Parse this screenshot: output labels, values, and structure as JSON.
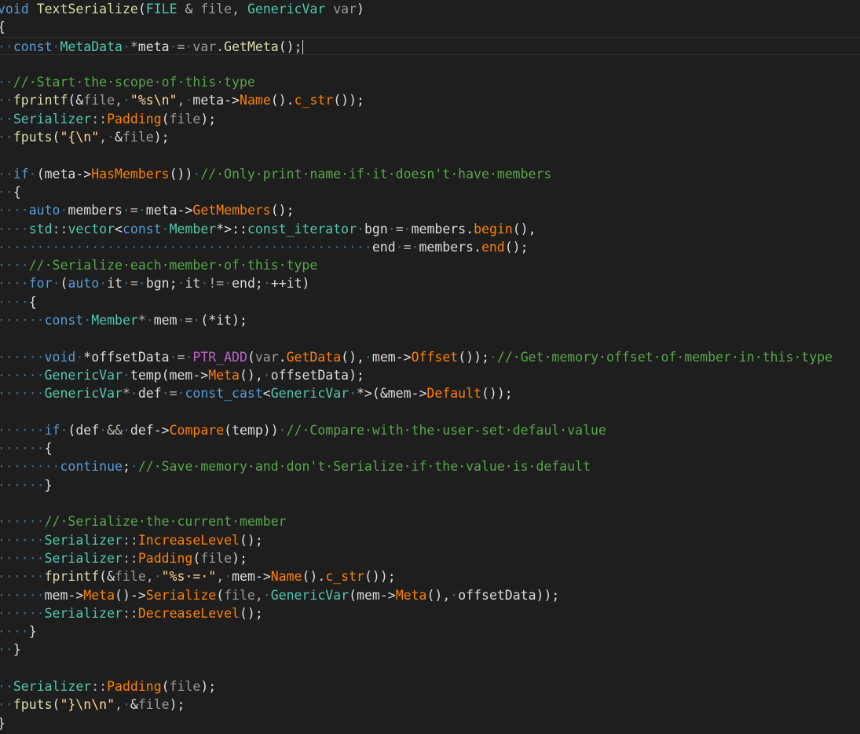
{
  "editor": {
    "lines": [
      [
        [
          "kw",
          "void"
        ],
        [
          "ws",
          " "
        ],
        [
          "fn",
          "TextSerialize"
        ],
        [
          "plain",
          "("
        ],
        [
          "type",
          "FILE"
        ],
        [
          "ws",
          " "
        ],
        [
          "op",
          "&"
        ],
        [
          "ws",
          " "
        ],
        [
          "param",
          "file"
        ],
        [
          "op",
          ","
        ],
        [
          "ws",
          " "
        ],
        [
          "type",
          "GenericVar"
        ],
        [
          "ws",
          " "
        ],
        [
          "param",
          "var"
        ],
        [
          "plain",
          ")"
        ]
      ],
      [
        [
          "plain",
          "{"
        ]
      ],
      [
        [
          "ws",
          "··"
        ],
        [
          "kw",
          "const"
        ],
        [
          "ws",
          "·"
        ],
        [
          "type",
          "MetaData"
        ],
        [
          "ws",
          "·"
        ],
        [
          "op",
          "*"
        ],
        [
          "plain",
          "meta"
        ],
        [
          "ws",
          "·"
        ],
        [
          "op",
          "="
        ],
        [
          "ws",
          "·"
        ],
        [
          "param",
          "var"
        ],
        [
          "op",
          "."
        ],
        [
          "fn",
          "GetMeta"
        ],
        [
          "plain",
          "();"
        ]
      ],
      [],
      [
        [
          "ws",
          "··"
        ],
        [
          "com",
          "//·Start·the·scope·of·this·type"
        ]
      ],
      [
        [
          "ws",
          "··"
        ],
        [
          "fn",
          "fprintf"
        ],
        [
          "plain",
          "(&"
        ],
        [
          "param",
          "file"
        ],
        [
          "op",
          ","
        ],
        [
          "ws",
          "·"
        ],
        [
          "strx",
          "\"%s\\n\""
        ],
        [
          "op",
          ","
        ],
        [
          "ws",
          "·"
        ],
        [
          "plain",
          "meta->"
        ],
        [
          "fld",
          "Name"
        ],
        [
          "plain",
          "()."
        ],
        [
          "fld",
          "c_str"
        ],
        [
          "plain",
          "());"
        ]
      ],
      [
        [
          "ws",
          "··"
        ],
        [
          "ns",
          "Serializer"
        ],
        [
          "op",
          "::"
        ],
        [
          "fld",
          "Padding"
        ],
        [
          "plain",
          "("
        ],
        [
          "param",
          "file"
        ],
        [
          "plain",
          ");"
        ]
      ],
      [
        [
          "ws",
          "··"
        ],
        [
          "fn",
          "fputs"
        ],
        [
          "plain",
          "("
        ],
        [
          "strx",
          "\"{\\n\""
        ],
        [
          "op",
          ","
        ],
        [
          "ws",
          "·"
        ],
        [
          "plain",
          "&"
        ],
        [
          "param",
          "file"
        ],
        [
          "plain",
          ");"
        ]
      ],
      [],
      [
        [
          "ws",
          "··"
        ],
        [
          "kw",
          "if"
        ],
        [
          "ws",
          "·"
        ],
        [
          "plain",
          "(meta->"
        ],
        [
          "fld",
          "HasMembers"
        ],
        [
          "plain",
          "())"
        ],
        [
          "ws",
          "·"
        ],
        [
          "com",
          "//·Only·print·name·if·it·doesn't·have·members"
        ]
      ],
      [
        [
          "ws",
          "··"
        ],
        [
          "plain",
          "{"
        ]
      ],
      [
        [
          "ws",
          "····"
        ],
        [
          "kw",
          "auto"
        ],
        [
          "ws",
          "·"
        ],
        [
          "plain",
          "members"
        ],
        [
          "ws",
          "·"
        ],
        [
          "op",
          "="
        ],
        [
          "ws",
          "·"
        ],
        [
          "plain",
          "meta->"
        ],
        [
          "fld",
          "GetMembers"
        ],
        [
          "plain",
          "();"
        ]
      ],
      [
        [
          "ws",
          "····"
        ],
        [
          "ns",
          "std"
        ],
        [
          "op",
          "::"
        ],
        [
          "type",
          "vector"
        ],
        [
          "plain",
          "<"
        ],
        [
          "kw",
          "const"
        ],
        [
          "ws",
          "·"
        ],
        [
          "type",
          "Member"
        ],
        [
          "plain",
          "*>::"
        ],
        [
          "type",
          "const_iterator"
        ],
        [
          "ws",
          "·"
        ],
        [
          "plain",
          "bgn"
        ],
        [
          "ws",
          "·"
        ],
        [
          "op",
          "="
        ],
        [
          "ws",
          "·"
        ],
        [
          "plain",
          "members."
        ],
        [
          "fld",
          "begin"
        ],
        [
          "plain",
          "(),"
        ]
      ],
      [
        [
          "ws",
          "················································"
        ],
        [
          "plain",
          "end"
        ],
        [
          "ws",
          "·"
        ],
        [
          "op",
          "="
        ],
        [
          "ws",
          "·"
        ],
        [
          "plain",
          "members."
        ],
        [
          "fld",
          "end"
        ],
        [
          "plain",
          "();"
        ]
      ],
      [
        [
          "ws",
          "····"
        ],
        [
          "com",
          "//·Serialize·each·member·of·this·type"
        ]
      ],
      [
        [
          "ws",
          "····"
        ],
        [
          "kw",
          "for"
        ],
        [
          "ws",
          "·"
        ],
        [
          "plain",
          "("
        ],
        [
          "kw",
          "auto"
        ],
        [
          "ws",
          "·"
        ],
        [
          "plain",
          "it"
        ],
        [
          "ws",
          "·"
        ],
        [
          "op",
          "="
        ],
        [
          "ws",
          "·"
        ],
        [
          "plain",
          "bgn;"
        ],
        [
          "ws",
          "·"
        ],
        [
          "plain",
          "it"
        ],
        [
          "ws",
          "·"
        ],
        [
          "op",
          "!="
        ],
        [
          "ws",
          "·"
        ],
        [
          "plain",
          "end;"
        ],
        [
          "ws",
          "·"
        ],
        [
          "plain",
          "++it)"
        ]
      ],
      [
        [
          "ws",
          "····"
        ],
        [
          "plain",
          "{"
        ]
      ],
      [
        [
          "ws",
          "······"
        ],
        [
          "kw",
          "const"
        ],
        [
          "ws",
          "·"
        ],
        [
          "type",
          "Member"
        ],
        [
          "op",
          "*"
        ],
        [
          "ws",
          "·"
        ],
        [
          "plain",
          "mem"
        ],
        [
          "ws",
          "·"
        ],
        [
          "op",
          "="
        ],
        [
          "ws",
          "·"
        ],
        [
          "plain",
          "(*it);"
        ]
      ],
      [],
      [
        [
          "ws",
          "······"
        ],
        [
          "kw",
          "void"
        ],
        [
          "ws",
          "·"
        ],
        [
          "plain",
          "*offsetData"
        ],
        [
          "ws",
          "·"
        ],
        [
          "op",
          "="
        ],
        [
          "ws",
          "·"
        ],
        [
          "macro",
          "PTR_ADD"
        ],
        [
          "plain",
          "("
        ],
        [
          "param",
          "var"
        ],
        [
          "plain",
          "."
        ],
        [
          "fld",
          "GetData"
        ],
        [
          "plain",
          "(),"
        ],
        [
          "ws",
          "·"
        ],
        [
          "plain",
          "mem->"
        ],
        [
          "fld",
          "Offset"
        ],
        [
          "plain",
          "());"
        ],
        [
          "ws",
          "·"
        ],
        [
          "com",
          "//·Get·memory·offset·of·member·in·this·type"
        ]
      ],
      [
        [
          "ws",
          "······"
        ],
        [
          "type",
          "GenericVar"
        ],
        [
          "ws",
          "·"
        ],
        [
          "plain",
          "temp(mem->"
        ],
        [
          "fld",
          "Meta"
        ],
        [
          "plain",
          "(),"
        ],
        [
          "ws",
          "·"
        ],
        [
          "plain",
          "offsetData);"
        ]
      ],
      [
        [
          "ws",
          "······"
        ],
        [
          "type",
          "GenericVar"
        ],
        [
          "op",
          "*"
        ],
        [
          "ws",
          "·"
        ],
        [
          "plain",
          "def"
        ],
        [
          "ws",
          "·"
        ],
        [
          "op",
          "="
        ],
        [
          "ws",
          "·"
        ],
        [
          "kw",
          "const_cast"
        ],
        [
          "plain",
          "<"
        ],
        [
          "type",
          "GenericVar"
        ],
        [
          "ws",
          "·"
        ],
        [
          "plain",
          "*>(&mem->"
        ],
        [
          "fld",
          "Default"
        ],
        [
          "plain",
          "());"
        ]
      ],
      [],
      [
        [
          "ws",
          "······"
        ],
        [
          "kw",
          "if"
        ],
        [
          "ws",
          "·"
        ],
        [
          "plain",
          "(def"
        ],
        [
          "ws",
          "·"
        ],
        [
          "op",
          "&&"
        ],
        [
          "ws",
          "·"
        ],
        [
          "plain",
          "def->"
        ],
        [
          "fld",
          "Compare"
        ],
        [
          "plain",
          "(temp))"
        ],
        [
          "ws",
          "·"
        ],
        [
          "com",
          "//·Compare·with·the·user-set·defaul·value"
        ]
      ],
      [
        [
          "ws",
          "······"
        ],
        [
          "plain",
          "{"
        ]
      ],
      [
        [
          "ws",
          "········"
        ],
        [
          "kw",
          "continue"
        ],
        [
          "plain",
          ";"
        ],
        [
          "ws",
          "·"
        ],
        [
          "com",
          "//·Save·memory·and·don't·Serialize·if·the·value·is·default"
        ]
      ],
      [
        [
          "ws",
          "······"
        ],
        [
          "plain",
          "}"
        ]
      ],
      [],
      [
        [
          "ws",
          "······"
        ],
        [
          "com",
          "//·Serialize·the·current·member"
        ]
      ],
      [
        [
          "ws",
          "······"
        ],
        [
          "ns",
          "Serializer"
        ],
        [
          "op",
          "::"
        ],
        [
          "fld",
          "IncreaseLevel"
        ],
        [
          "plain",
          "();"
        ]
      ],
      [
        [
          "ws",
          "······"
        ],
        [
          "ns",
          "Serializer"
        ],
        [
          "op",
          "::"
        ],
        [
          "fld",
          "Padding"
        ],
        [
          "plain",
          "("
        ],
        [
          "param",
          "file"
        ],
        [
          "plain",
          ");"
        ]
      ],
      [
        [
          "ws",
          "······"
        ],
        [
          "fn",
          "fprintf"
        ],
        [
          "plain",
          "(&"
        ],
        [
          "param",
          "file"
        ],
        [
          "op",
          ","
        ],
        [
          "ws",
          "·"
        ],
        [
          "strx",
          "\"%s·=·\""
        ],
        [
          "op",
          ","
        ],
        [
          "ws",
          "·"
        ],
        [
          "plain",
          "mem->"
        ],
        [
          "fld",
          "Name"
        ],
        [
          "plain",
          "()."
        ],
        [
          "fld",
          "c_str"
        ],
        [
          "plain",
          "());"
        ]
      ],
      [
        [
          "ws",
          "······"
        ],
        [
          "plain",
          "mem->"
        ],
        [
          "fld",
          "Meta"
        ],
        [
          "plain",
          "()->"
        ],
        [
          "fld",
          "Serialize"
        ],
        [
          "plain",
          "("
        ],
        [
          "param",
          "file"
        ],
        [
          "op",
          ","
        ],
        [
          "ws",
          "·"
        ],
        [
          "type",
          "GenericVar"
        ],
        [
          "plain",
          "(mem->"
        ],
        [
          "fld",
          "Meta"
        ],
        [
          "plain",
          "(),"
        ],
        [
          "ws",
          "·"
        ],
        [
          "plain",
          "offsetData));"
        ]
      ],
      [
        [
          "ws",
          "······"
        ],
        [
          "ns",
          "Serializer"
        ],
        [
          "op",
          "::"
        ],
        [
          "fld",
          "DecreaseLevel"
        ],
        [
          "plain",
          "();"
        ]
      ],
      [
        [
          "ws",
          "····"
        ],
        [
          "plain",
          "}"
        ]
      ],
      [
        [
          "ws",
          "··"
        ],
        [
          "plain",
          "}"
        ]
      ],
      [],
      [
        [
          "ws",
          "··"
        ],
        [
          "ns",
          "Serializer"
        ],
        [
          "op",
          "::"
        ],
        [
          "fld",
          "Padding"
        ],
        [
          "plain",
          "("
        ],
        [
          "param",
          "file"
        ],
        [
          "plain",
          ");"
        ]
      ],
      [
        [
          "ws",
          "··"
        ],
        [
          "fn",
          "fputs"
        ],
        [
          "plain",
          "("
        ],
        [
          "strx",
          "\"}\\n\\n\""
        ],
        [
          "op",
          ","
        ],
        [
          "ws",
          "·"
        ],
        [
          "plain",
          "&"
        ],
        [
          "param",
          "file"
        ],
        [
          "plain",
          ");"
        ]
      ],
      [
        [
          "plain",
          "}"
        ]
      ]
    ]
  }
}
